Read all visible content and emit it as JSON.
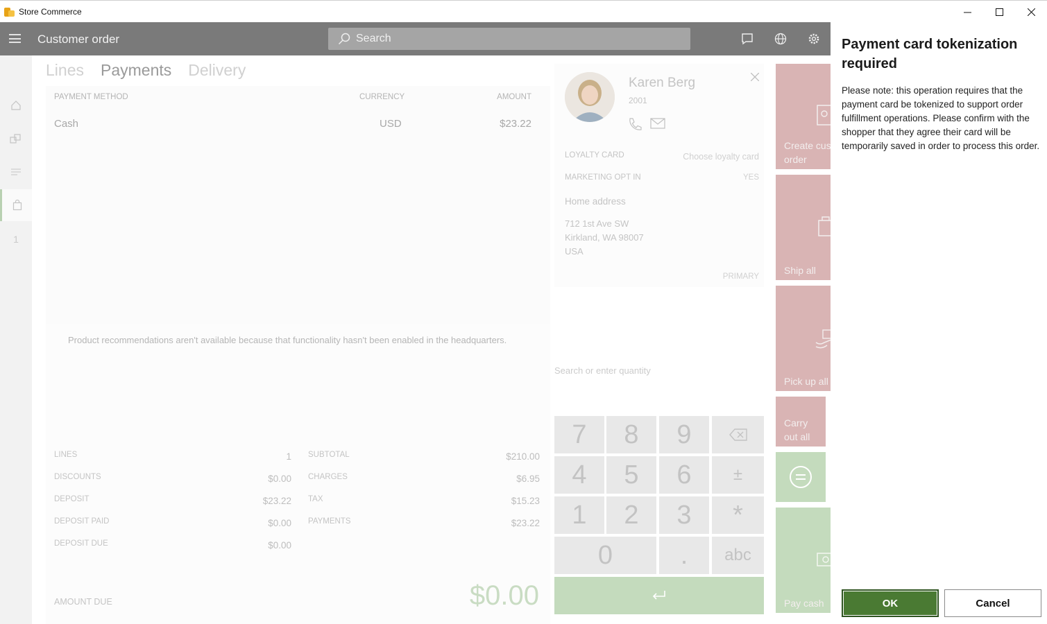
{
  "window": {
    "title": "Store Commerce",
    "minimize_icon": "minimize-icon",
    "maximize_icon": "maximize-icon",
    "close_icon": "close-icon"
  },
  "header": {
    "page_title": "Customer order",
    "search_placeholder": "Search",
    "icons": [
      "menu-icon",
      "search-icon",
      "message-icon",
      "globe-icon",
      "gear-icon"
    ]
  },
  "rail": {
    "icons": [
      "home-icon",
      "products-icon",
      "list-icon",
      "bag-icon"
    ],
    "number": "1"
  },
  "tabs": [
    {
      "label": "Lines",
      "active": false
    },
    {
      "label": "Payments",
      "active": true
    },
    {
      "label": "Delivery",
      "active": false
    }
  ],
  "payments": {
    "columns": {
      "method": "PAYMENT METHOD",
      "currency": "CURRENCY",
      "amount": "AMOUNT"
    },
    "rows": [
      {
        "method": "Cash",
        "currency": "USD",
        "amount": "$23.22"
      }
    ]
  },
  "recommendations_text": "Product recommendations aren't available because that functionality hasn't been enabled in the headquarters.",
  "totals": {
    "lines_label": "LINES",
    "lines_value": "1",
    "discounts_label": "DISCOUNTS",
    "discounts_value": "$0.00",
    "deposit_label": "DEPOSIT",
    "deposit_value": "$23.22",
    "deposit_paid_label": "DEPOSIT PAID",
    "deposit_paid_value": "$0.00",
    "deposit_due_label": "DEPOSIT DUE",
    "deposit_due_value": "$0.00",
    "subtotal_label": "SUBTOTAL",
    "subtotal_value": "$210.00",
    "charges_label": "CHARGES",
    "charges_value": "$6.95",
    "tax_label": "TAX",
    "tax_value": "$15.23",
    "payments_label": "PAYMENTS",
    "payments_value": "$23.22",
    "amount_due_label": "AMOUNT DUE",
    "amount_due_value": "$0.00"
  },
  "customer": {
    "name": "Karen Berg",
    "id": "2001",
    "loyalty_label": "LOYALTY CARD",
    "loyalty_value": "Choose loyalty card",
    "marketing_label": "MARKETING OPT IN",
    "marketing_value": "YES",
    "address_title": "Home address",
    "address_line1": "712 1st Ave SW",
    "address_line2": "Kirkland, WA 98007",
    "address_line3": "USA",
    "address_tag": "PRIMARY"
  },
  "numpad": {
    "search_placeholder": "Search or enter quantity",
    "k7": "7",
    "k8": "8",
    "k9": "9",
    "k4": "4",
    "k5": "5",
    "k6": "6",
    "k1": "1",
    "k2": "2",
    "k3": "3",
    "k0": "0",
    "kdot": ".",
    "kabc": "abc",
    "kplusminus": "±",
    "kstar": "*"
  },
  "actions": {
    "create_line1": "Create cust",
    "create_line2": "order",
    "ship_all": "Ship all",
    "pick_up_all": "Pick up all",
    "carry_line1": "Carry",
    "carry_line2": "out all",
    "pay_cash": "Pay cash"
  },
  "dialog": {
    "title": "Payment card tokenization required",
    "message": "Please note: this operation requires that the payment card be tokenized to support order fulfillment operations. Please confirm with the shopper that they agree their card will be temporarily saved in order to process this order.",
    "ok_label": "OK",
    "cancel_label": "Cancel"
  },
  "colors": {
    "header_bg": "#7a7a7a",
    "accent_green": "#4a7a33",
    "tile_pink": "#d9b4b4",
    "tile_green": "#c4dbbd"
  }
}
